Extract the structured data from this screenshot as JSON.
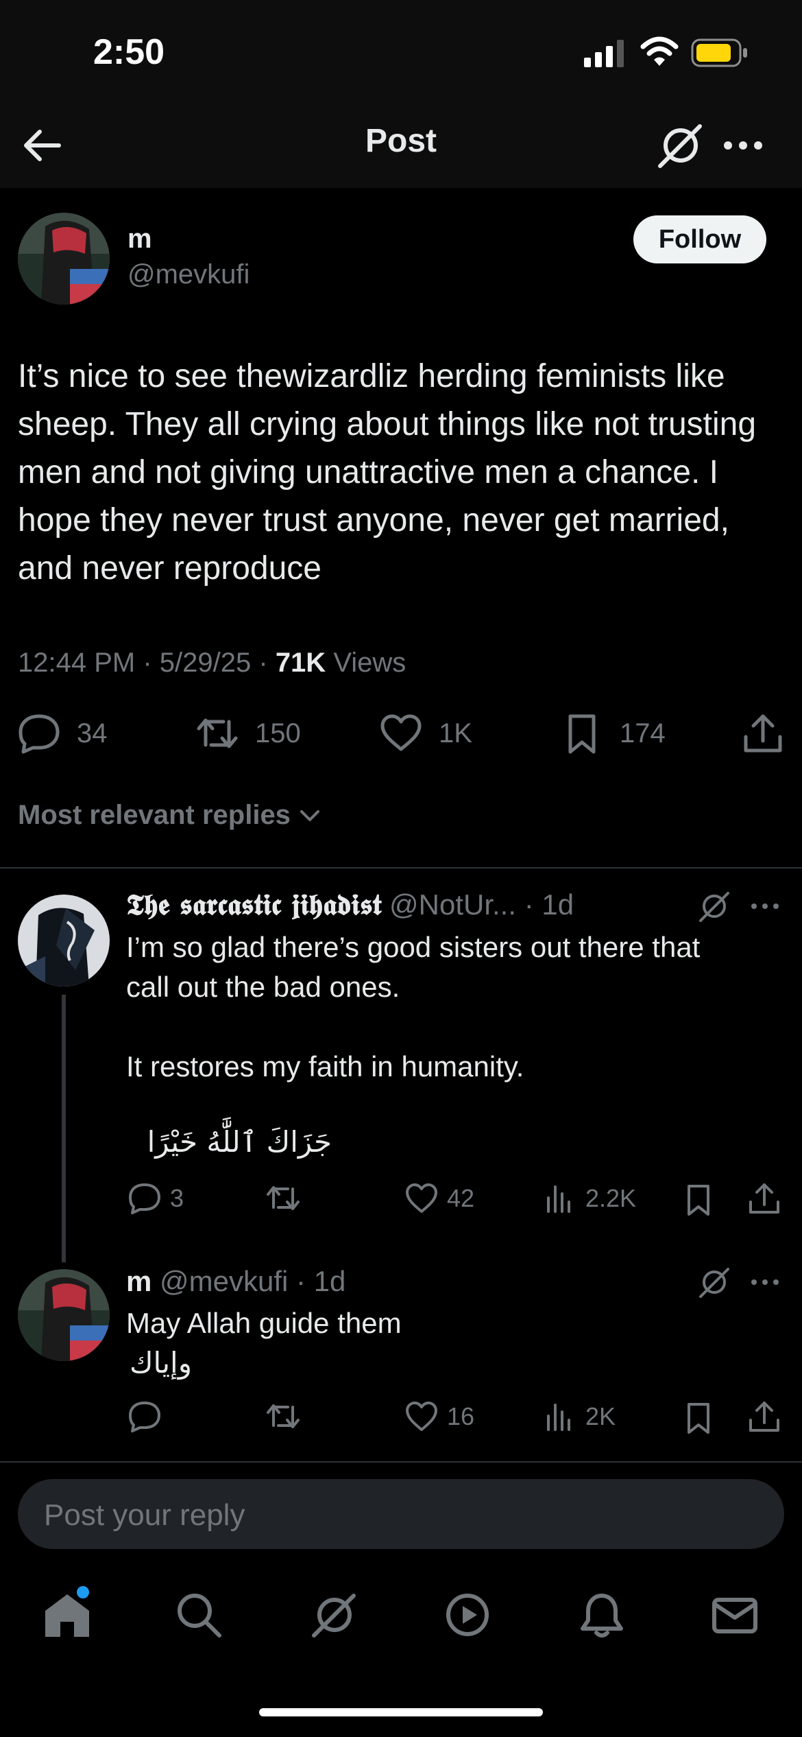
{
  "status_bar": {
    "time": "2:50"
  },
  "header": {
    "title": "Post"
  },
  "post": {
    "display_name": "m",
    "handle": "@mevkufi",
    "follow_label": "Follow",
    "text": "It’s nice to see thewizardliz herding feminists like sheep. They all crying about things like not trusting men and not giving unattractive men a chance. I hope they never trust anyone, never get married, and never reproduce",
    "time": "12:44 PM",
    "date": "5/29/25",
    "views_count": "71K",
    "views_label": "Views",
    "reply_count": "34",
    "repost_count": "150",
    "like_count": "1K",
    "bookmark_count": "174"
  },
  "sort": {
    "label": "Most relevant replies"
  },
  "replies": [
    {
      "display_name": "𝕿𝖍𝖊 𝖘𝖆𝖗𝖈𝖆𝖘𝖙𝖎𝖈 𝖏𝖎𝖍𝖆𝖉𝖎𝖘𝖙",
      "handle": "@NotUr...",
      "age": "1d",
      "line1": "I’m so glad there’s good sisters out there that",
      "line2": "call out the bad ones.",
      "line3": "It restores my faith in humanity.",
      "line4": "جَزَاكَ ٱللَّٰهُ خَيْرًا",
      "reply_count": "3",
      "like_count": "42",
      "views_count": "2.2K"
    },
    {
      "display_name": "m",
      "handle": "@mevkufi",
      "age": "1d",
      "line1": "May Allah guide them",
      "line2": "وإياك",
      "like_count": "16",
      "views_count": "2K"
    }
  ],
  "compose": {
    "placeholder": "Post your reply"
  },
  "colors": {
    "background": "#000000",
    "text": "#e7e9ea",
    "muted": "#71767b",
    "accent": "#1d9bf0"
  }
}
